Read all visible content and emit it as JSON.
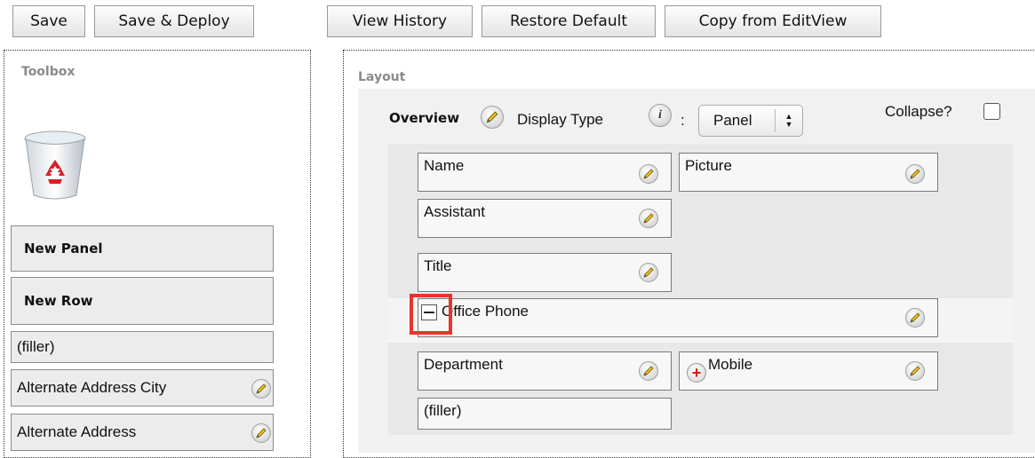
{
  "toolbar": {
    "save_label": "Save",
    "save_deploy_label": "Save & Deploy",
    "view_history_label": "View History",
    "restore_default_label": "Restore Default",
    "copy_editview_label": "Copy from EditView"
  },
  "toolbox": {
    "title": "Toolbox",
    "trash_icon": "recycle-bin-icon",
    "items": [
      {
        "label": "New Panel"
      },
      {
        "label": "New Row"
      },
      {
        "label": "(filler)"
      },
      {
        "label": "Alternate Address City"
      },
      {
        "label": "Alternate Address"
      }
    ]
  },
  "layout": {
    "title": "Layout",
    "panel": {
      "name": "Overview",
      "display_type_label": "Display Type",
      "info_icon": "i",
      "colon": ":",
      "display_type_value": "Panel",
      "collapse_label": "Collapse?"
    },
    "fields": {
      "name": "Name",
      "picture": "Picture",
      "assistant": "Assistant",
      "title": "Title",
      "office_phone": "Office Phone",
      "department": "Department",
      "mobile": "Mobile",
      "filler": "(filler)"
    }
  },
  "highlight_color": "#e8352a"
}
